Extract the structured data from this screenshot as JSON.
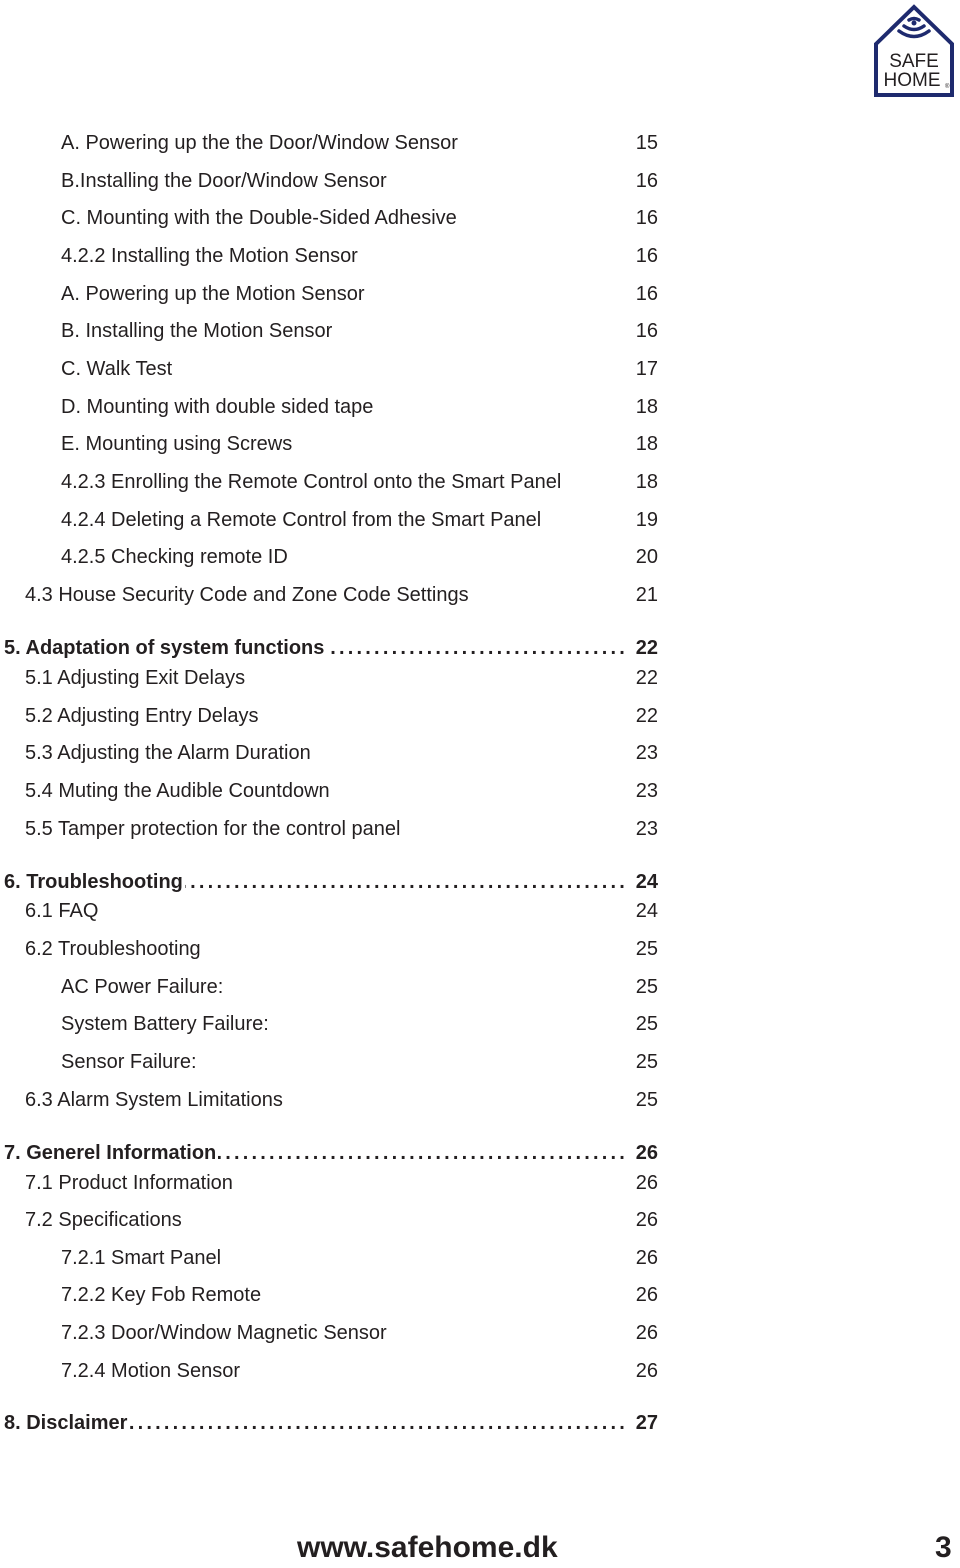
{
  "brand": {
    "logo_line1": "SAFE",
    "logo_line2": "HOME",
    "logo_mark": "®",
    "color": "#1e2a6e"
  },
  "toc": [
    {
      "level": 2,
      "label": "A. Powering up the the Door/Window Sensor",
      "page": "15"
    },
    {
      "level": 2,
      "label": "B.Installing the Door/Window Sensor",
      "page": "16"
    },
    {
      "level": 2,
      "label": "C. Mounting with the Double-Sided Adhesive",
      "page": "16"
    },
    {
      "level": 2,
      "label": "4.2.2 Installing the Motion Sensor",
      "page": "16"
    },
    {
      "level": 2,
      "label": "A. Powering up the Motion Sensor",
      "page": "16"
    },
    {
      "level": 2,
      "label": "B. Installing the Motion Sensor",
      "page": "16"
    },
    {
      "level": 2,
      "label": "C. Walk Test",
      "page": "17"
    },
    {
      "level": 2,
      "label": "D. Mounting with double sided tape",
      "page": "18"
    },
    {
      "level": 2,
      "label": "E. Mounting using Screws",
      "page": "18"
    },
    {
      "level": 2,
      "label": "4.2.3 Enrolling the Remote Control onto the Smart Panel",
      "page": "18"
    },
    {
      "level": 2,
      "label": "4.2.4 Deleting a Remote Control from the Smart Panel",
      "page": "19"
    },
    {
      "level": 2,
      "label": "4.2.5 Checking remote ID",
      "page": "20"
    },
    {
      "level": 1,
      "label": "4.3 House Security Code and Zone Code Settings",
      "page": "21"
    },
    {
      "level": 0,
      "label": "5. Adaptation of system functions",
      "page": "22"
    },
    {
      "level": 1,
      "label": "5.1 Adjusting Exit Delays",
      "page": "22"
    },
    {
      "level": 1,
      "label": "5.2 Adjusting Entry Delays",
      "page": "22"
    },
    {
      "level": 1,
      "label": "5.3 Adjusting the Alarm Duration",
      "page": "23"
    },
    {
      "level": 1,
      "label": "5.4 Muting the Audible Countdown",
      "page": "23"
    },
    {
      "level": 1,
      "label": "5.5 Tamper protection for the control panel",
      "page": "23"
    },
    {
      "level": 0,
      "label": "6. Troubleshooting",
      "page": "24"
    },
    {
      "level": 1,
      "label": "6.1 FAQ",
      "page": "24"
    },
    {
      "level": 1,
      "label": "6.2 Troubleshooting",
      "page": "25"
    },
    {
      "level": 2,
      "label": "AC Power Failure:",
      "page": "25"
    },
    {
      "level": 2,
      "label": "System Battery Failure:",
      "page": "25"
    },
    {
      "level": 2,
      "label": "Sensor Failure:",
      "page": "25"
    },
    {
      "level": 1,
      "label": "6.3 Alarm System Limitations",
      "page": "25"
    },
    {
      "level": 0,
      "label": "7. Generel Information",
      "page": "26"
    },
    {
      "level": 1,
      "label": "7.1 Product Information",
      "page": "26"
    },
    {
      "level": 1,
      "label": "7.2 Specifications",
      "page": "26"
    },
    {
      "level": 2,
      "label": "7.2.1 Smart Panel",
      "page": "26"
    },
    {
      "level": 2,
      "label": "7.2.2 Key Fob Remote",
      "page": "26"
    },
    {
      "level": 2,
      "label": "7.2.3 Door/Window Magnetic Sensor",
      "page": "26"
    },
    {
      "level": 2,
      "label": "7.2.4 Motion Sensor",
      "page": "26"
    },
    {
      "level": 0,
      "label": "8. Disclaimer",
      "page": "27"
    }
  ],
  "footer": {
    "url": "www.safehome.dk",
    "page_number": "3"
  }
}
